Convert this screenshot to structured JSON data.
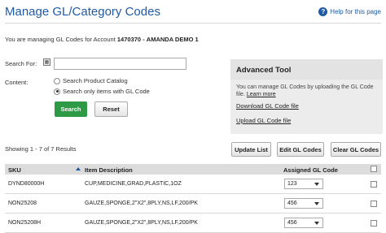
{
  "header": {
    "title": "Manage GL/Category Codes",
    "help_label": "Help for this page",
    "help_icon": "?"
  },
  "account": {
    "prefix": "You are managing GL Codes for Account",
    "number": "1470370",
    "separator": "-",
    "name": "AMANDA DEMO 1"
  },
  "search": {
    "label": "Search For:",
    "value": "",
    "placeholder": "",
    "content_label": "Content:",
    "options": [
      {
        "label": "Search Product Catalog",
        "selected": false
      },
      {
        "label": "Search only items with GL Code",
        "selected": true
      }
    ],
    "search_button": "Search",
    "reset_button": "Reset"
  },
  "advanced": {
    "title": "Advanced Tool",
    "text_before": "You can manage GL Codes by uploading the GL Code file.",
    "learn_more": "Learn more",
    "download": "Download GL Code file",
    "upload": "Upload GL Code file"
  },
  "results": {
    "showing": "Showing 1 - 7 of 7 Results",
    "update_button": "Update List",
    "edit_button": "Edit GL Codes",
    "clear_button": "Clear GL Codes"
  },
  "table": {
    "columns": [
      "SKU",
      "Item Description",
      "Assigned GL Code"
    ],
    "rows": [
      {
        "sku": "DYND80000H",
        "description": "CUP,MEDICINE,GRAD,PLASTIC,1OZ",
        "code": "123"
      },
      {
        "sku": "NON25208",
        "description": "GAUZE,SPONGE,2\"X2\",8PLY,NS,LF,200/PK",
        "code": "456"
      },
      {
        "sku": "NON25208H",
        "description": "GAUZE,SPONGE,2\"X2\",8PLY,NS,LF,200/PK",
        "code": "456"
      }
    ]
  },
  "colors": {
    "brand_blue": "#1e5aa5",
    "search_green": "#2e9a45",
    "header_gray": "#dcdcdc"
  }
}
